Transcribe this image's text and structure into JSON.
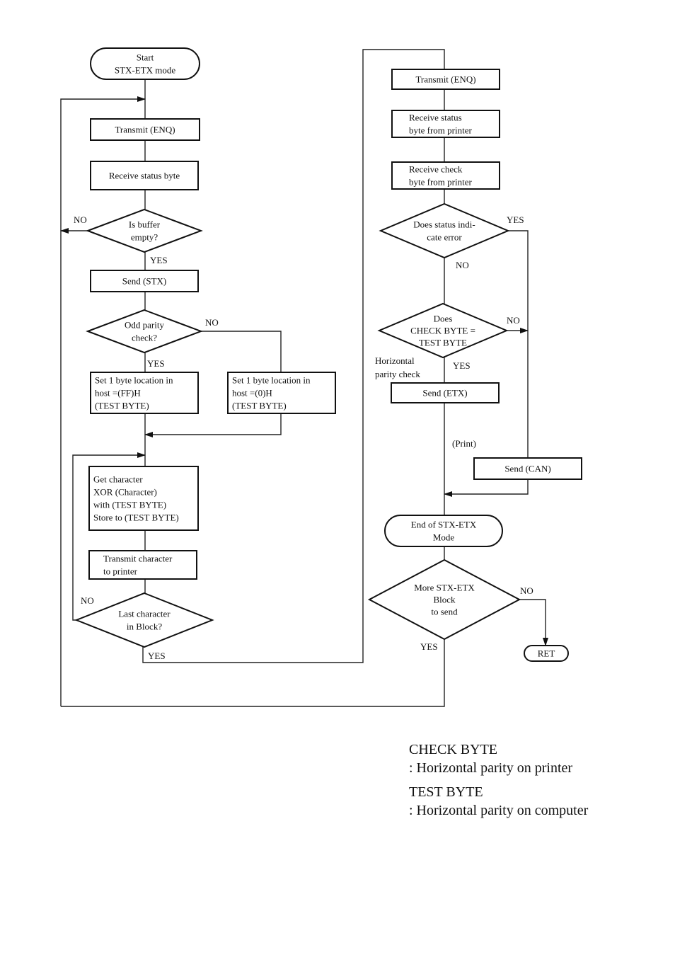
{
  "nodes": {
    "start": [
      "Start",
      "STX-ETX mode"
    ],
    "transmit_enq_1": [
      "Transmit (ENQ)"
    ],
    "receive_status_1": [
      "Receive status byte"
    ],
    "buffer_empty": [
      "Is buffer",
      "empty?"
    ],
    "send_stx": [
      "Send (STX)"
    ],
    "odd_parity": [
      "Odd parity",
      "check?"
    ],
    "set_ff": [
      "Set 1 byte location in",
      "host  =(FF)H",
      "(TEST BYTE)"
    ],
    "set_0": [
      "Set 1 byte location in",
      "host  =(0)H",
      "(TEST BYTE)"
    ],
    "xor_block": [
      "Get character",
      "XOR (Character)",
      "with (TEST BYTE)",
      "Store to (TEST BYTE)"
    ],
    "transmit_char": [
      "Transmit character",
      "to printer"
    ],
    "last_char": [
      "Last character",
      "in Block?"
    ],
    "transmit_enq_2": [
      "Transmit (ENQ)"
    ],
    "receive_status_2": [
      "Receive status",
      "byte from printer"
    ],
    "receive_check": [
      "Receive check",
      "byte from printer"
    ],
    "status_error": [
      "Does status indi-",
      "cate error"
    ],
    "check_eq_test": [
      "Does",
      "CHECK BYTE =",
      "TEST BYTE"
    ],
    "send_etx": [
      "Send (ETX)"
    ],
    "send_can": [
      "Send (CAN)"
    ],
    "end_mode": [
      "End of STX-ETX",
      "Mode"
    ],
    "more_blocks": [
      "More STX-ETX",
      "Block",
      "to send"
    ],
    "ret": [
      "RET"
    ]
  },
  "edge_labels": {
    "buffer_no": "NO",
    "buffer_yes": "YES",
    "parity_no": "NO",
    "parity_yes": "YES",
    "last_no": "NO",
    "last_yes": "YES",
    "error_yes": "YES",
    "error_no": "NO",
    "check_no": "NO",
    "check_yes": "YES",
    "horizontal_parity": [
      "Horizontal",
      "parity check"
    ],
    "print": "(Print)",
    "more_no": "NO",
    "more_yes": "YES"
  },
  "legend": [
    {
      "term": "CHECK BYTE",
      "definition": ": Horizontal parity on printer"
    },
    {
      "term": "TEST BYTE",
      "definition": ": Horizontal parity on computer"
    }
  ]
}
